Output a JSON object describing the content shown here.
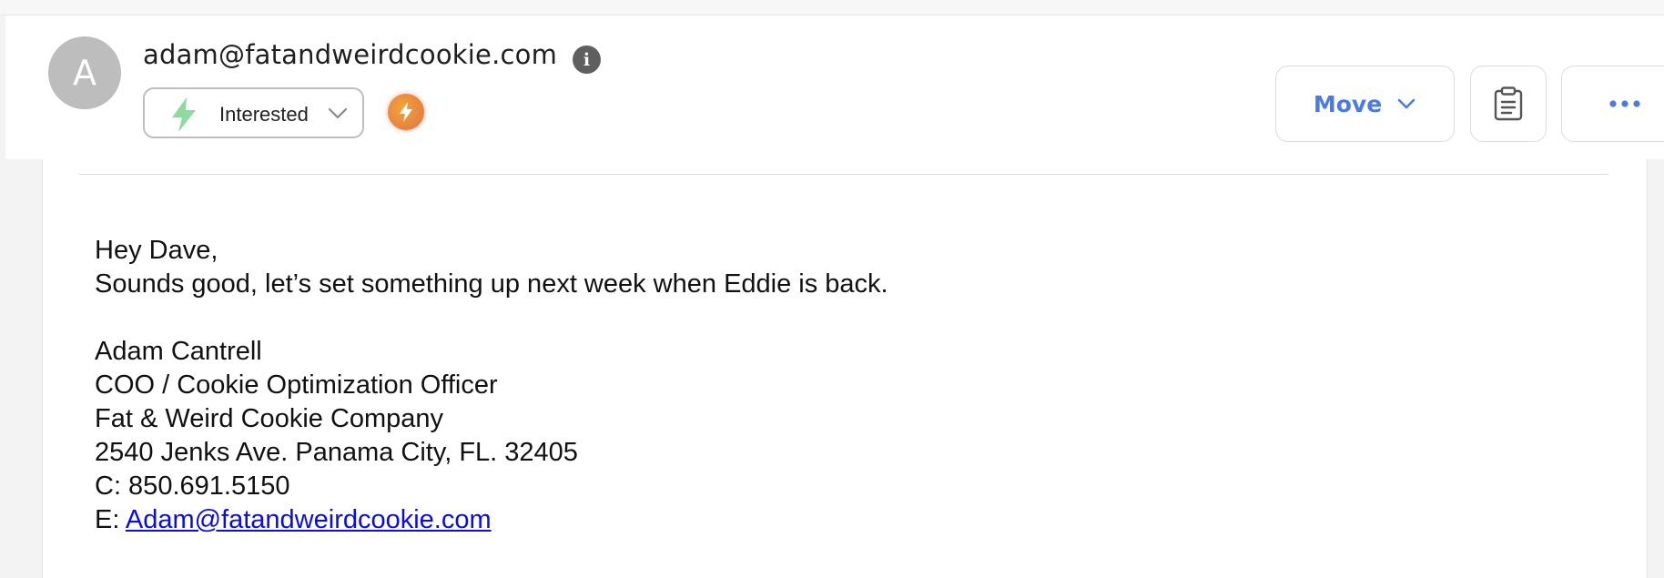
{
  "header": {
    "avatar_letter": "A",
    "sender_email": "adam@fatandweirdcookie.com",
    "status_label": "Interested",
    "move_label": "Move",
    "more_label": "···"
  },
  "message": {
    "greeting": "Hey Dave,",
    "body": "Sounds good, let’s set something up next week when Eddie is back.",
    "signature": {
      "name": "Adam Cantrell",
      "title": "COO / Cookie Optimization Officer",
      "company": "Fat & Weird Cookie Company",
      "address": "2540 Jenks Ave. Panama City, FL. 32405",
      "phone": "C: 850.691.5150",
      "email_prefix": "E: ",
      "email_link": "Adam@fatandweirdcookie.com"
    }
  },
  "colors": {
    "accent": "#4a7ae3",
    "status_green": "#8fdb9d",
    "link": "#0b0be8",
    "avatar_bg": "#bdbdbd"
  },
  "icons": {
    "status": "lightning-bolt-icon",
    "ai": "ai-bolt-badge-icon",
    "info": "info-icon",
    "notes": "clipboard-icon",
    "more": "more-horizontal-icon",
    "chevron": "chevron-down-icon"
  }
}
